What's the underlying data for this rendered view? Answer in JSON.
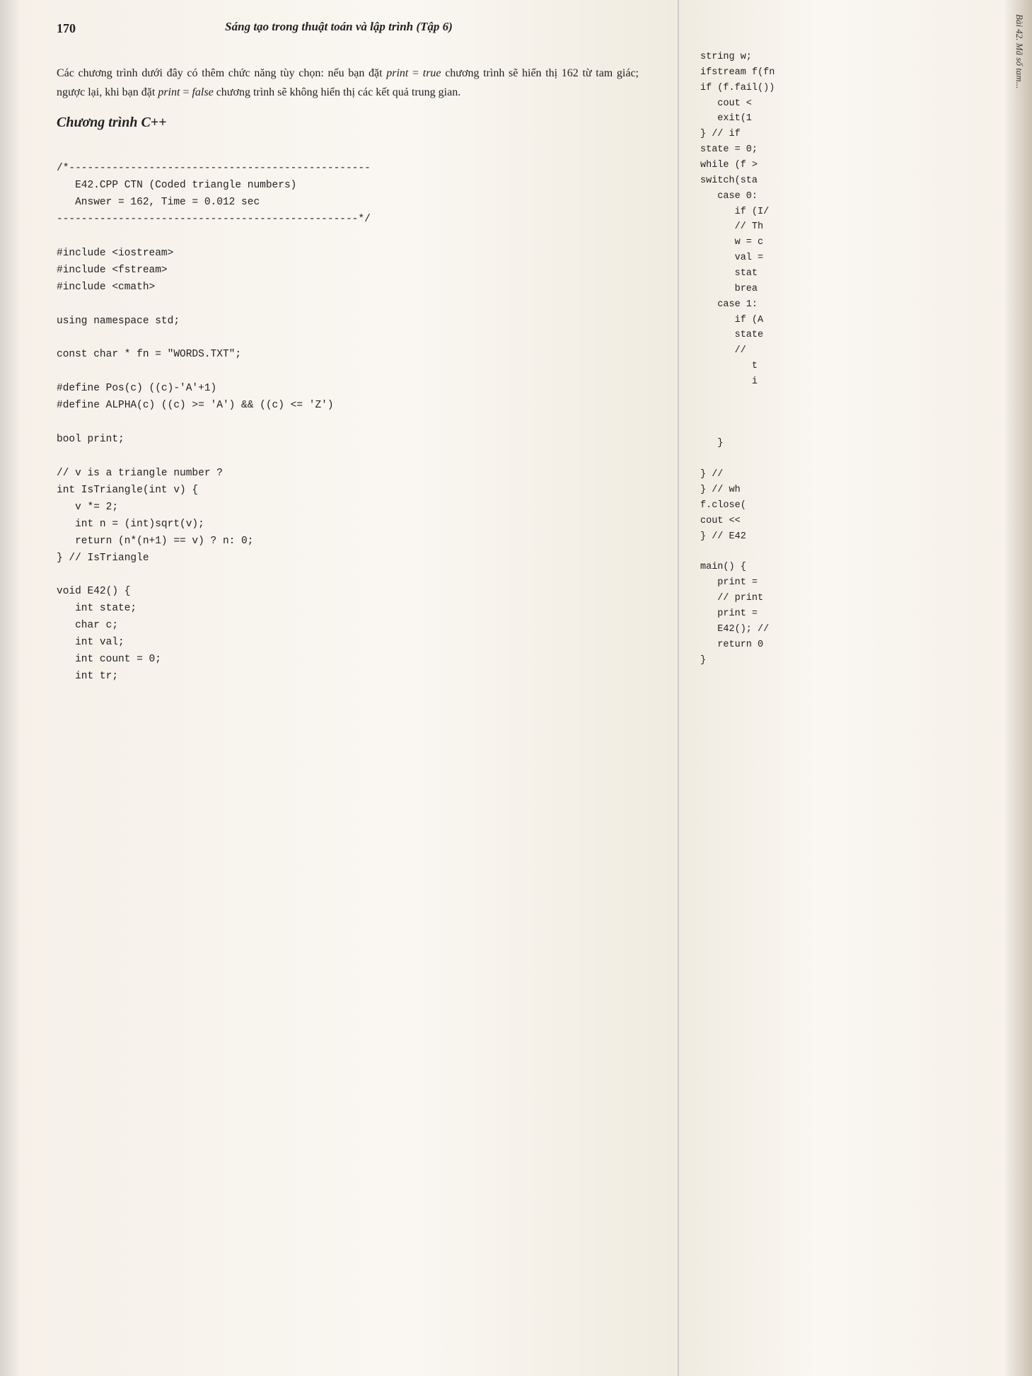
{
  "left_page": {
    "page_number": "170",
    "header_title": "Sáng tạo trong thuật toán và lập trình (Tập 6)",
    "intro_paragraph": "Các chương trình dưới đây có thêm chức năng tùy chọn: nếu bạn đặt print = true chương trình sẽ hiển thị 162 từ tam giác; ngược lại, khi bạn đặt print = false chương trình sẽ không hiển thị các kết quả trung gian.",
    "section_title": "Chương trình C++",
    "code_comment_line1": "/*-------------------------------------------------",
    "code_comment_line2": "   E42.CPP CTN (Coded triangle numbers)",
    "code_comment_line3": "   Answer = 162, Time = 0.012 sec",
    "code_comment_line4": "-------------------------------------------------*/",
    "code_body": "#include <iostream>\n#include <fstream>\n#include <cmath>\n\nusing namespace std;\n\nconst char * fn = \"WORDS.TXT\";\n\n#define Pos(c) ((c)-'A'+1)\n#define ALPHA(c) ((c) >= 'A') && ((c) <= 'Z')\n\nbool print;\n\n// v is a triangle number ?\nint IsTriangle(int v) {\n   v *= 2;\n   int n = (int)sqrt(v);\n   return (n*(n+1) == v) ? n: 0;\n} // IsTriangle\n\nvoid E42() {\n   int state;\n   char c;\n   int val;\n   int count = 0;\n   int tr;"
  },
  "right_page": {
    "tab_label": "Bài 42. Mã số tam...",
    "code_body": "string w;\nifstream f(fn\nif (f.fail())\n   cout <\n   exit(1\n} // if\nstate = 0;\nwhile (f >\nswitch(sta\n   case 0:\n      if (I/\n      // Th\n      w = c\n      val =\n      stat\n      brea\n   case 1:\n      if (A\n      state\n      //\n         t\n         i\n\n\n\n   }\n\n} //\n} // wh\nf.close(\ncout <<\n} // E42\n\nmain() {\n   print =\n   // print\n   print =\n   E42(); //\n   return 0\n}"
  }
}
